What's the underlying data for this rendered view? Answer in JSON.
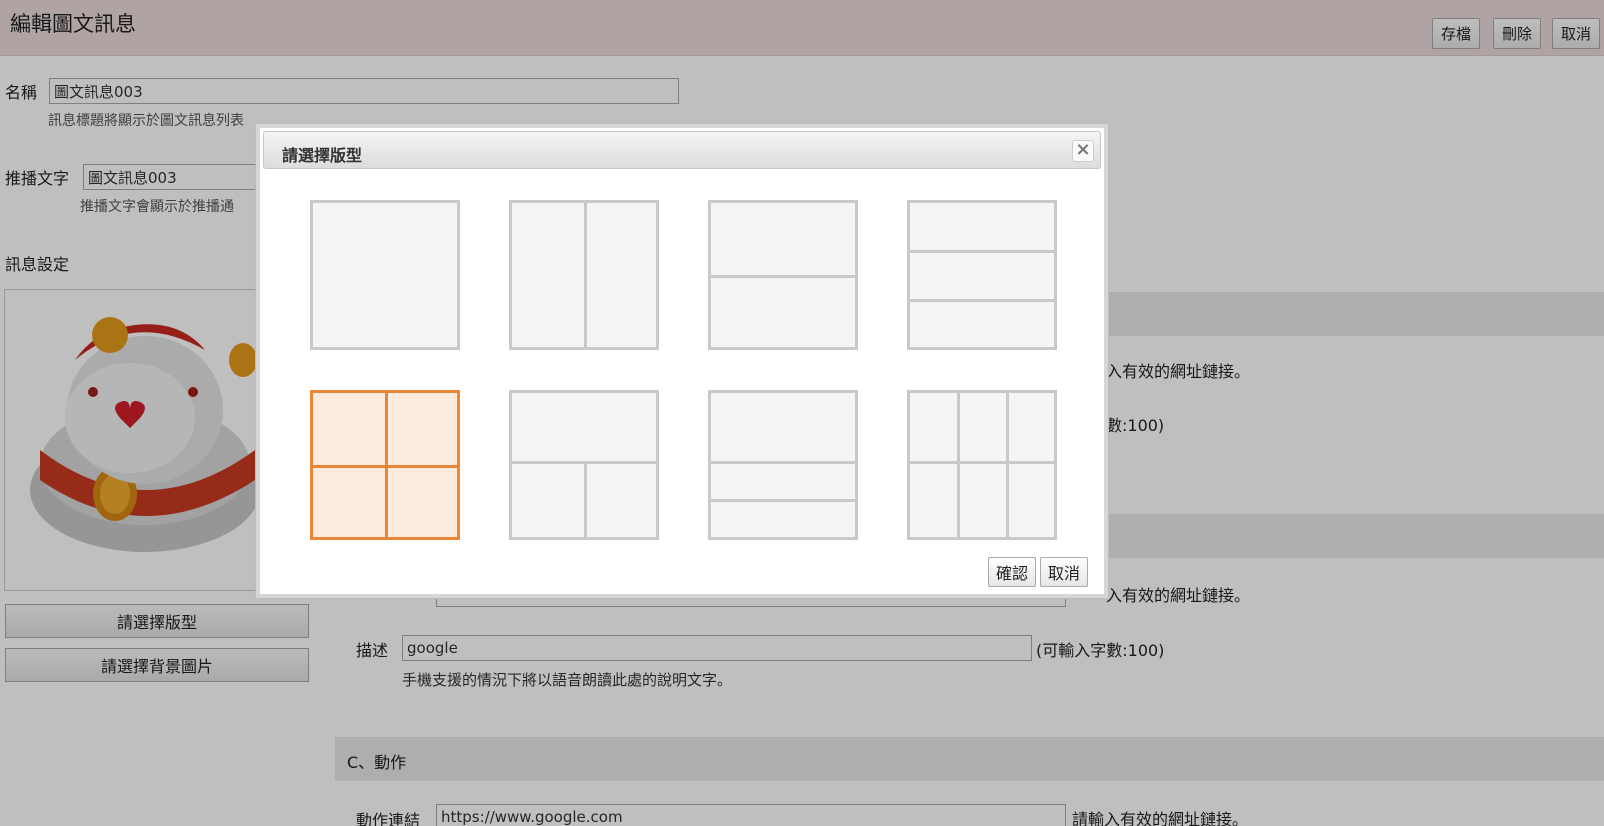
{
  "header": {
    "title": "編輯圖文訊息",
    "save_label": "存檔",
    "delete_label": "刪除",
    "cancel_label": "取消"
  },
  "form": {
    "name_label": "名稱",
    "name_value": "圖文訊息003",
    "name_hint": "訊息標題將顯示於圖文訊息列表",
    "push_label": "推播文字",
    "push_value": "圖文訊息003",
    "push_hint": "推播文字會顯示於推播通",
    "settings_label": "訊息設定"
  },
  "sidebar": {
    "choose_layout_label": "請選擇版型",
    "choose_bg_label": "請選擇背景圖片"
  },
  "sections": {
    "partial_hint_1": "入有效的網址鏈接。",
    "partial_count_1": "數:100)",
    "partial_hint_2": "入有效的網址鏈接。",
    "desc_label": "描述",
    "desc_value": "google",
    "desc_count": "(可輸入字數:100)",
    "desc_hint": "手機支援的情況下將以語音朗讀此處的說明文字。",
    "section_c_label": "C、動作",
    "action_link_label": "動作連結",
    "action_link_value": "https://www.google.com",
    "action_link_hint": "請輸入有效的網址鏈接。"
  },
  "dialog": {
    "title": "請選擇版型",
    "close_glyph": "×",
    "confirm_label": "確認",
    "cancel_label": "取消",
    "selected_layout": "layout-2x2",
    "accent_color": "#e98637"
  },
  "colors": {
    "header_bg": "#eadada",
    "layout_border": "#c9c9c9",
    "selected_fill": "#fdebdd"
  }
}
